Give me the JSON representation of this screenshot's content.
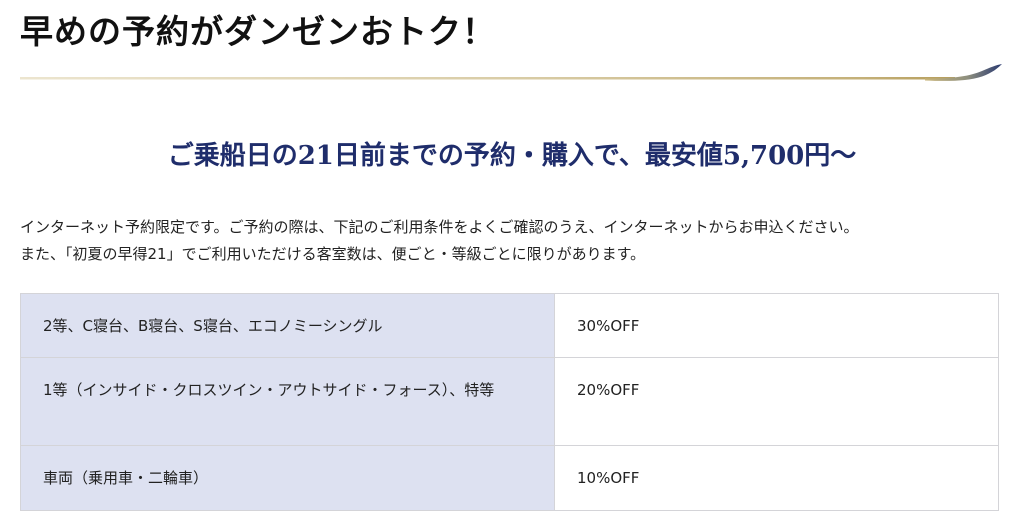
{
  "page": {
    "heading": "早めの予約がダンゼンおトク！"
  },
  "headline": "ご乗船日の21日前までの予約・購入で、最安値5,700円〜",
  "intro": {
    "line1": "インターネット予約限定です。ご予約の際は、下記のご利用条件をよくご確認のうえ、インターネットからお申込ください。",
    "line2": "また、「初夏の早得21」でご利用いただける客室数は、便ごと・等級ごとに限りがあります。"
  },
  "discounts": [
    {
      "category": "2等、C寝台、B寝台、S寝台、エコノミーシングル",
      "rate": "30%OFF"
    },
    {
      "category": "1等（インサイド・クロスツイン・アウトサイド・フォース）、特等",
      "rate": "20%OFF"
    },
    {
      "category": "車両（乗用車・二輪車）",
      "rate": "10%OFF"
    }
  ],
  "colors": {
    "headline": "#1f2d6b",
    "table_category_bg": "#dde1f1",
    "rule_gold": "#c9b98a",
    "rule_navy": "#2a3a70"
  }
}
